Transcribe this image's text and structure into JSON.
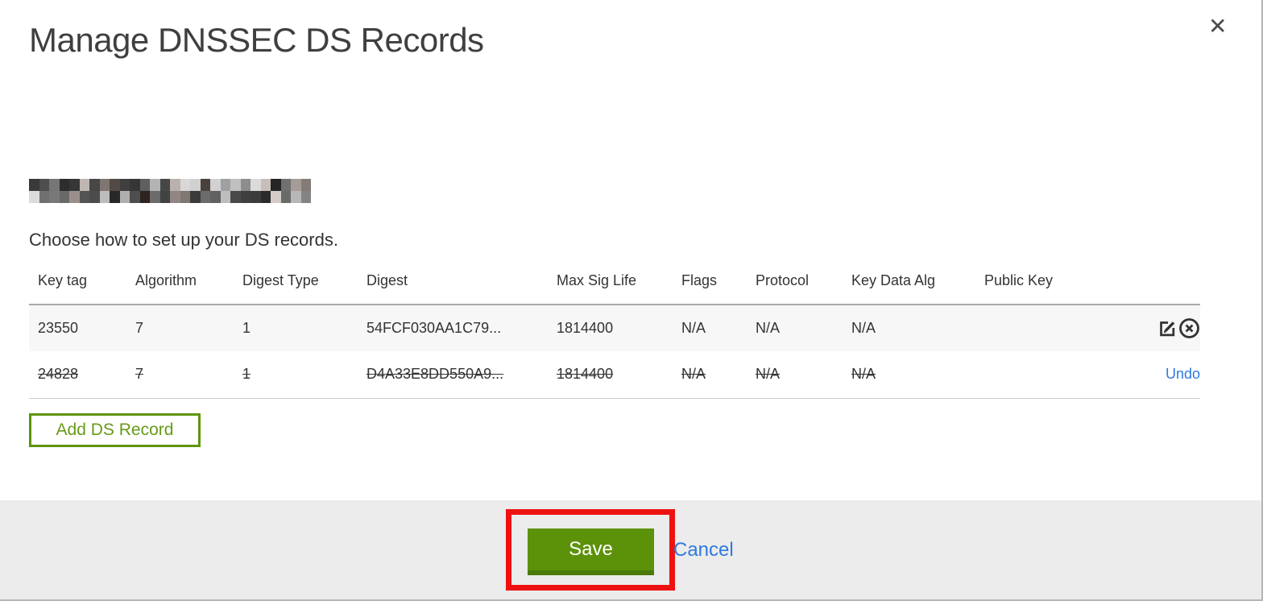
{
  "header": {
    "title": "Manage DNSSEC DS Records",
    "close_glyph": "✕"
  },
  "content": {
    "domain_redacted": true,
    "instruction": "Choose how to set up your DS records.",
    "table": {
      "columns": [
        "Key tag",
        "Algorithm",
        "Digest Type",
        "Digest",
        "Max Sig Life",
        "Flags",
        "Protocol",
        "Key Data Alg",
        "Public Key",
        ""
      ],
      "rows": [
        {
          "key_tag": "23550",
          "algorithm": "7",
          "digest_type": "1",
          "digest": "54FCF030AA1C79...",
          "max_sig_life": "1814400",
          "flags": "N/A",
          "protocol": "N/A",
          "key_data_alg": "N/A",
          "public_key": "",
          "state": "active",
          "actions": [
            "edit",
            "remove"
          ]
        },
        {
          "key_tag": "24828",
          "algorithm": "7",
          "digest_type": "1",
          "digest": "D4A33E8DD550A9...",
          "max_sig_life": "1814400",
          "flags": "N/A",
          "protocol": "N/A",
          "key_data_alg": "N/A",
          "public_key": "",
          "state": "deleted",
          "actions": [
            "undo"
          ],
          "undo_label": "Undo"
        }
      ]
    },
    "add_button_label": "Add DS Record"
  },
  "footer": {
    "save_label": "Save",
    "cancel_label": "Cancel"
  },
  "colors": {
    "accent_green": "#5c920a",
    "accent_green_dark": "#4c7a08",
    "link_blue": "#2d7be0",
    "annotation_red": "#ee1111",
    "row_gray": "#f7f7f7",
    "footer_gray": "#ececec"
  }
}
